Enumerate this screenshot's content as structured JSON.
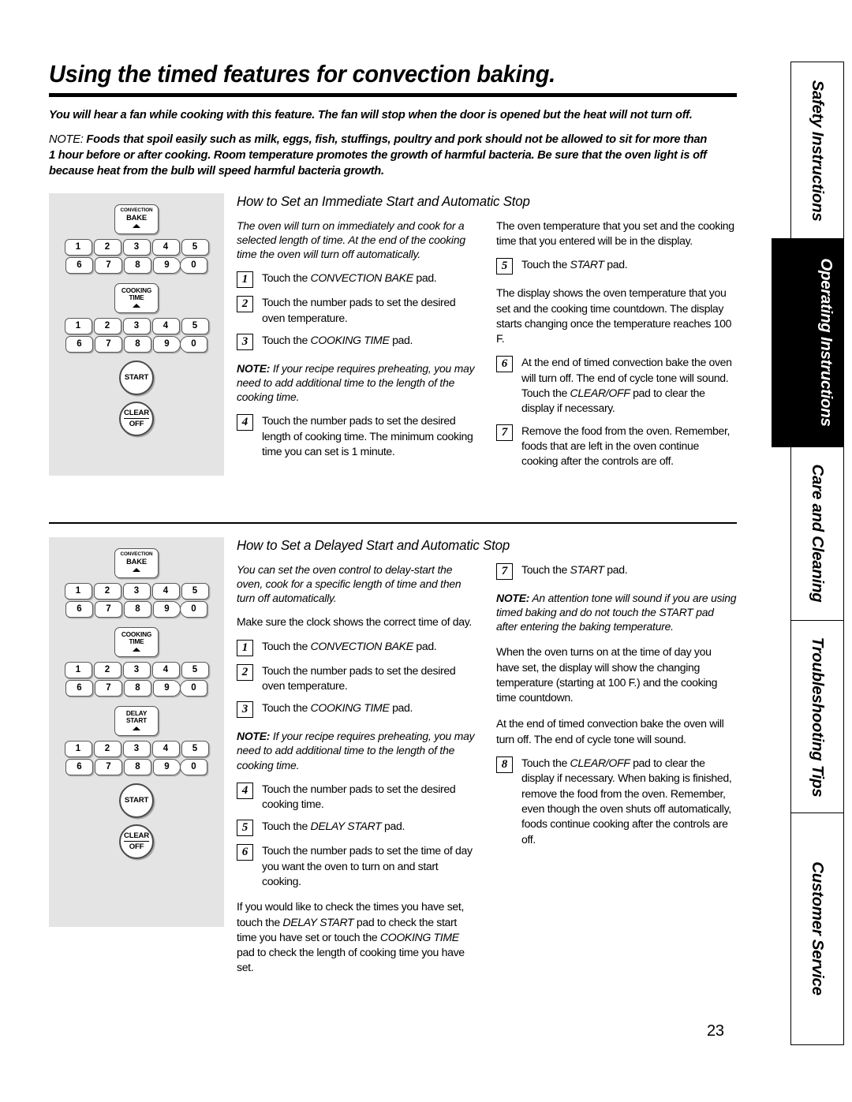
{
  "page": {
    "title": "Using the timed features for convection baking.",
    "number": "23"
  },
  "intro": {
    "p1": "You will hear a fan while cooking with this feature. The fan will stop when the door is opened but the heat will not turn off.",
    "note_lead": "NOTE:",
    "p2": " Foods that spoil easily  such as milk, eggs, fish, stuffings, poultry and pork  should not be allowed to sit for more than 1 hour before or after cooking. Room temperature promotes the growth of harmful bacteria. Be sure that the oven light is off because heat from the bulb will speed harmful bacteria growth."
  },
  "panel_labels": {
    "convection_bake_l1": "CONVECTION",
    "convection_bake_l2": "BAKE",
    "cooking_time_l1": "COOKING",
    "cooking_time_l2": "TIME",
    "delay_start_l1": "DELAY",
    "delay_start_l2": "START",
    "start": "START",
    "clear": "CLEAR",
    "off": "OFF",
    "keys_row1": [
      "1",
      "2",
      "3",
      "4",
      "5"
    ],
    "keys_row2": [
      "6",
      "7",
      "8",
      "9",
      "0"
    ]
  },
  "section1": {
    "heading": "How to Set an Immediate Start and Automatic Stop",
    "left": {
      "lead": "The oven will turn on immediately and cook for a selected length of time. At the end of the cooking time the oven will turn off automatically.",
      "steps": [
        {
          "num": "1",
          "text": "Touch the CONVECTION BAKE pad."
        },
        {
          "num": "2",
          "text": "Touch the number pads to set the desired oven temperature."
        },
        {
          "num": "3",
          "text": "Touch the COOKING TIME pad."
        }
      ],
      "note_lead": "NOTE:",
      "note": " If your recipe requires preheating, you may need to add additional time to the length of the cooking time.",
      "steps2": [
        {
          "num": "4",
          "text": "Touch the number pads to set the desired length of cooking time. The minimum cooking time you can set is 1 minute."
        }
      ]
    },
    "right": {
      "lead": "The oven temperature that you set and the cooking time that you entered will be in the display.",
      "step5": {
        "num": "5",
        "text": "Touch the START pad."
      },
      "mid": "The display shows the oven temperature that you set and the cooking time countdown. The display starts changing once the temperature reaches 100  F.",
      "steps": [
        {
          "num": "6",
          "text": "At the end of timed convection bake the oven will turn off. The end of cycle tone will sound. Touch the CLEAR/OFF pad to clear the display if necessary."
        },
        {
          "num": "7",
          "text": "Remove the food from the oven. Remember, foods that are left in the oven continue cooking after the controls are off."
        }
      ]
    }
  },
  "section2": {
    "heading": "How to Set a Delayed Start and Automatic Stop",
    "left": {
      "lead": "You can set the oven control to delay-start the oven, cook for a specific length of time and then turn off automatically.",
      "clock": "Make sure the clock shows the correct time of day.",
      "steps": [
        {
          "num": "1",
          "text": "Touch the CONVECTION BAKE pad."
        },
        {
          "num": "2",
          "text": "Touch the number pads to set the desired oven temperature."
        },
        {
          "num": "3",
          "text": "Touch the COOKING TIME pad."
        }
      ],
      "note_lead": "NOTE:",
      "note": " If your recipe requires preheating, you may need to add additional time to the length of the cooking time.",
      "steps2": [
        {
          "num": "4",
          "text": "Touch the number pads to set the desired cooking time."
        },
        {
          "num": "5",
          "text": "Touch the DELAY START pad."
        },
        {
          "num": "6",
          "text": "Touch the number pads to set the time of day you want the oven to turn on and start cooking."
        }
      ],
      "tail": "If you would like to check the times you have set, touch the DELAY START pad to check the start time you have set or touch the COOKING TIME pad to check the length of cooking time you have set."
    },
    "right": {
      "step7": {
        "num": "7",
        "text": "Touch the START pad."
      },
      "note_lead": "NOTE:",
      "note": " An attention tone will sound if you are using timed baking and do not touch the START pad after entering the baking temperature.",
      "p1": "When the oven turns on at the time of day you have set, the display will show the changing temperature (starting at 100  F.) and the cooking time countdown.",
      "p2": "At the end of timed convection bake the oven will turn off. The end of cycle tone will sound.",
      "step8": {
        "num": "8",
        "text": "Touch the CLEAR/OFF pad to clear the display if necessary. When baking is finished, remove the food from the oven. Remember, even though the oven shuts off automatically, foods continue cooking after the controls are off."
      }
    }
  },
  "tabs": [
    {
      "label": "Safety Instructions",
      "active": false
    },
    {
      "label": "Operating Instructions",
      "active": true
    },
    {
      "label": "Care and Cleaning",
      "active": false
    },
    {
      "label": "Troubleshooting Tips",
      "active": false
    },
    {
      "label": "Customer Service",
      "active": false
    }
  ]
}
